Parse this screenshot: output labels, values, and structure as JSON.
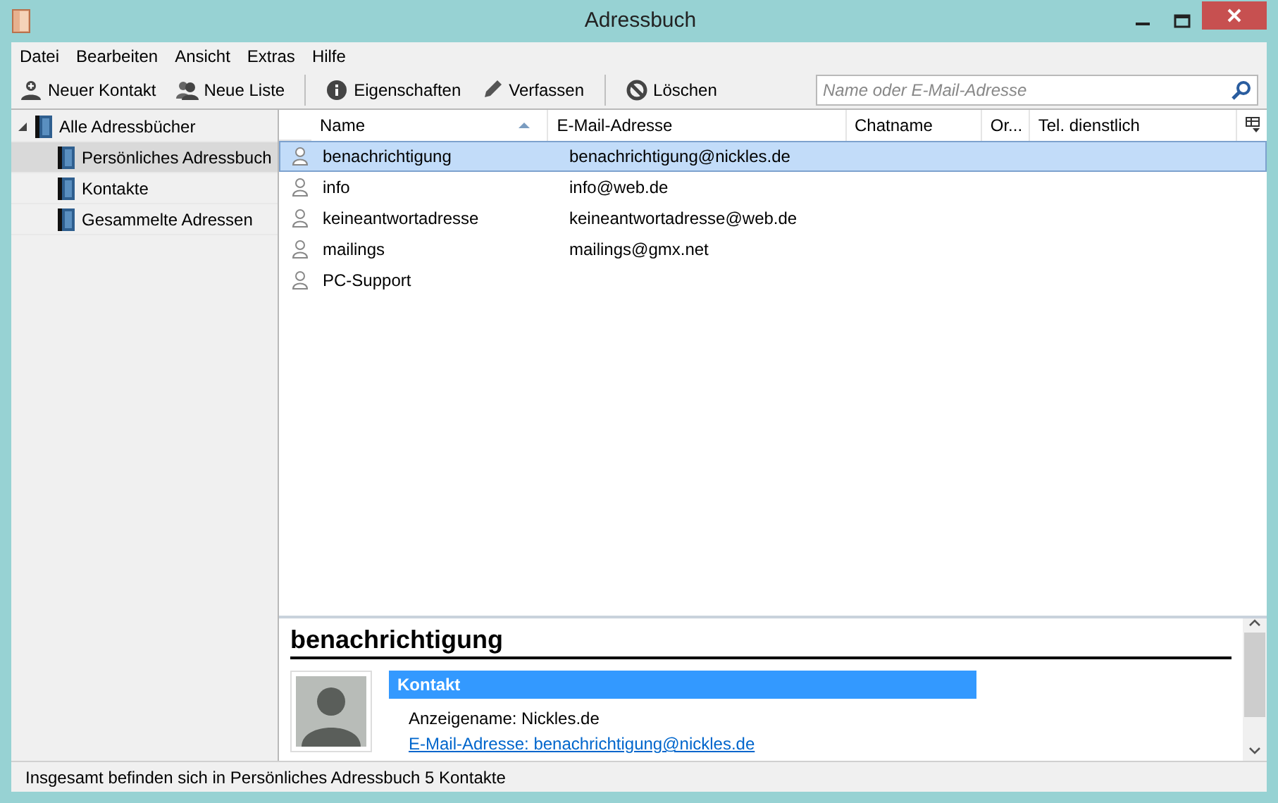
{
  "window": {
    "title": "Adressbuch"
  },
  "menu": [
    "Datei",
    "Bearbeiten",
    "Ansicht",
    "Extras",
    "Hilfe"
  ],
  "toolbar": [
    {
      "kind": "new-contact",
      "label": "Neuer Kontakt"
    },
    {
      "kind": "new-list",
      "label": "Neue Liste"
    },
    {
      "kind": "separator"
    },
    {
      "kind": "properties",
      "label": "Eigenschaften"
    },
    {
      "kind": "compose",
      "label": "Verfassen"
    },
    {
      "kind": "separator"
    },
    {
      "kind": "delete",
      "label": "Löschen"
    }
  ],
  "search": {
    "placeholder": "Name oder E-Mail-Adresse"
  },
  "sidebar": {
    "items": [
      {
        "label": "Alle Adressbücher",
        "expanded": true,
        "selected": false,
        "children": [
          {
            "label": "Persönliches Adressbuch",
            "selected": true
          },
          {
            "label": "Kontakte",
            "selected": false
          },
          {
            "label": "Gesammelte Adressen",
            "selected": false
          }
        ]
      }
    ]
  },
  "table": {
    "columns": [
      {
        "label": "Name",
        "sorted": true
      },
      {
        "label": "E-Mail-Adresse",
        "sorted": false
      },
      {
        "label": "Chatname",
        "sorted": false
      },
      {
        "label": "Or...",
        "sorted": false
      },
      {
        "label": "Tel. dienstlich",
        "sorted": false
      }
    ],
    "rows": [
      {
        "name": "benachrichtigung",
        "email": "benachrichtigung@nickles.de",
        "selected": true
      },
      {
        "name": "info",
        "email": "info@web.de",
        "selected": false
      },
      {
        "name": "keineantwortadresse",
        "email": "keineantwortadresse@web.de",
        "selected": false
      },
      {
        "name": "mailings",
        "email": "mailings@gmx.net",
        "selected": false
      },
      {
        "name": "PC-Support",
        "selected": false
      }
    ]
  },
  "preview": {
    "name": "benachrichtigung",
    "section": "Kontakt",
    "display_name": "Anzeigename: Nickles.de",
    "email_link": "E-Mail-Adresse: benachrichtigung@nickles.de"
  },
  "status_bar": "Insgesamt befinden sich in Persönliches Adressbuch 5 Kontakte"
}
